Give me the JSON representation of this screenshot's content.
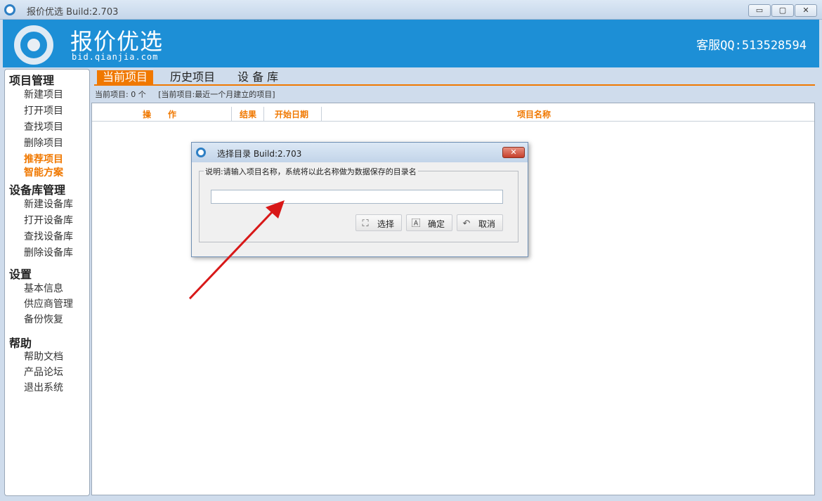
{
  "window": {
    "title": "报价优选   Build:2.703",
    "min": "▭",
    "max": "▢",
    "close": "✕"
  },
  "banner": {
    "brand": "报价优选",
    "domain": "bid.qianjia.com",
    "service": "客服QQ:513528594",
    "accent": "#1d8fd6"
  },
  "sidebar": {
    "groups": [
      {
        "label": "项目管理",
        "items": [
          "新建项目",
          "打开项目",
          "查找项目",
          "删除项目",
          "推荐项目",
          "智能方案"
        ]
      },
      {
        "label": "设备库管理",
        "items": [
          "新建设备库",
          "打开设备库",
          "查找设备库",
          "删除设备库"
        ]
      },
      {
        "label": "设置",
        "items": [
          "基本信息",
          "供应商管理",
          "备份恢复"
        ]
      },
      {
        "label": "帮助",
        "items": [
          "帮助文档",
          "产品论坛",
          "退出系统"
        ]
      }
    ],
    "highlight_color": "#f07800"
  },
  "tabs": [
    {
      "label": "当前项目",
      "active": true
    },
    {
      "label": "历史项目",
      "active": false
    },
    {
      "label": "设 备 库",
      "active": false
    }
  ],
  "status": {
    "count_text": "当前项目: 0 个",
    "hint": "[当前项目:最近一个月建立的项目]"
  },
  "grid": {
    "columns": [
      "操　　作",
      "结果",
      "开始日期",
      "项目名称"
    ]
  },
  "dialog": {
    "title": "选择目录   Build:2.703",
    "close": "✕",
    "legend": "说明:请输入项目名称，系统将以此名称做为数据保存的目录名",
    "input_value": "",
    "buttons": {
      "select": "选择",
      "ok": "确定",
      "cancel": "取消"
    },
    "icons": {
      "select": "select-icon",
      "ok": "confirm-icon",
      "cancel": "undo-icon"
    }
  }
}
